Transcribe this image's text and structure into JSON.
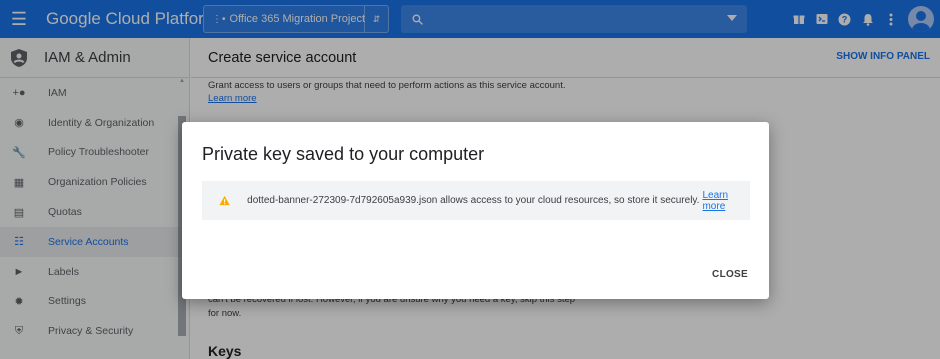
{
  "topbar": {
    "brand": "Google Cloud Platform",
    "project": "Office 365 Migration Project",
    "icons": [
      "menu-icon",
      "gift-icon",
      "cloud-shell-icon",
      "help-icon",
      "notifications-icon",
      "more-vert-icon",
      "account-avatar"
    ],
    "accent_color": "#1a73e8"
  },
  "sidebar": {
    "title": "IAM & Admin",
    "items": [
      {
        "label": "IAM",
        "icon": "person-add-icon"
      },
      {
        "label": "Identity & Organization",
        "icon": "identity-icon"
      },
      {
        "label": "Policy Troubleshooter",
        "icon": "wrench-icon"
      },
      {
        "label": "Organization Policies",
        "icon": "policy-icon"
      },
      {
        "label": "Quotas",
        "icon": "quotas-icon"
      },
      {
        "label": "Service Accounts",
        "icon": "service-accounts-icon",
        "active": true
      },
      {
        "label": "Labels",
        "icon": "label-icon"
      },
      {
        "label": "Settings",
        "icon": "settings-icon"
      },
      {
        "label": "Privacy & Security",
        "icon": "privacy-icon"
      }
    ]
  },
  "main": {
    "title": "Create service account",
    "info_panel": "SHOW INFO PANEL",
    "description": "Grant access to users or groups that need to perform actions as this service account.",
    "learn_more": "Learn more",
    "lower_text_1": "can't be recovered if lost. However, if you are unsure why you need a key, skip this step",
    "lower_text_2": "for now.",
    "keys_heading": "Keys"
  },
  "dialog": {
    "title": "Private key saved to your computer",
    "warning": "dotted-banner-272309-7d792605a939.json allows access to your cloud resources, so store it securely.",
    "learn_more": "Learn more",
    "close": "CLOSE",
    "warning_color": "#f9ab00"
  }
}
